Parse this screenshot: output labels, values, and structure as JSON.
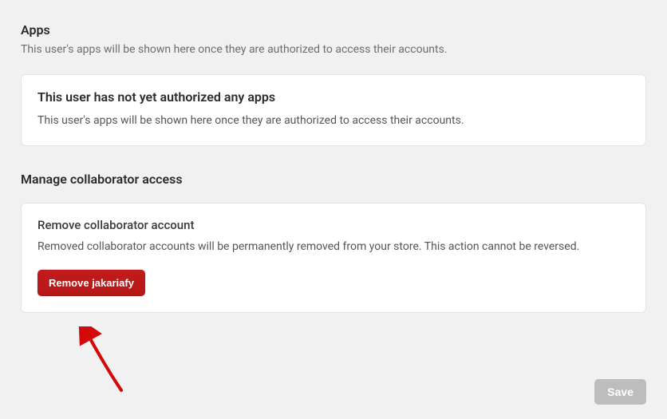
{
  "apps": {
    "title": "Apps",
    "description": "This user's apps will be shown here once they are authorized to access their accounts.",
    "empty_card": {
      "title": "This user has not yet authorized any apps",
      "text": "This user's apps will be shown here once they are authorized to access their accounts."
    }
  },
  "collaborator": {
    "title": "Manage collaborator access",
    "card": {
      "sub": "Remove collaborator account",
      "body": "Removed collaborator accounts will be permanently removed from your store. This action cannot be reversed.",
      "button_label": "Remove jakariafy"
    }
  },
  "footer": {
    "save": "Save"
  }
}
